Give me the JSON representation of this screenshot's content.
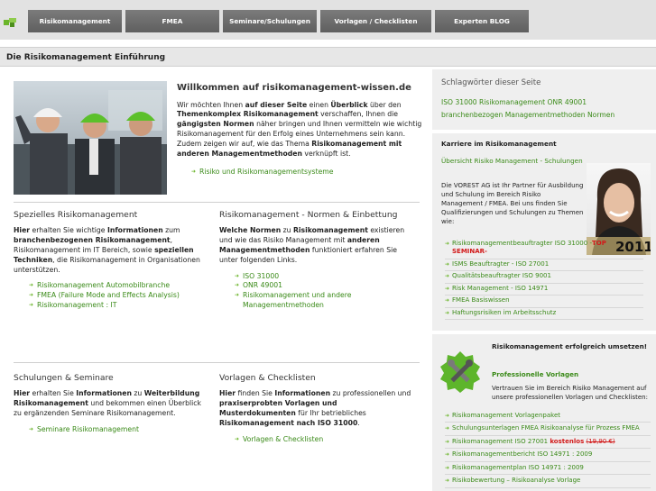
{
  "nav": {
    "items": [
      "Risikomanagement",
      "FMEA",
      "Seminare/Schulungen",
      "Vorlagen / Checklisten",
      "Experten BLOG"
    ]
  },
  "page": {
    "title": "Die Risikomanagement Einführung"
  },
  "welcome": {
    "title": "Willkommen auf risikomanagement-wissen.de",
    "t1": "Wir möchten Ihnen ",
    "b1": "auf dieser Seite",
    "t2": " einen ",
    "b2": "Überblick",
    "t3": " über den ",
    "b3": "Themenkomplex Risikomanagement",
    "t4": " verschaffen, Ihnen die ",
    "b4": "gängigsten Normen",
    "t5": " näher bringen und Ihnen vermitteln wie wichtig Risikomanagement für den Erfolg eines Unternehmens sein kann. Zudem zeigen wir auf, wie das Thema ",
    "b5": "Risikomanagement mit anderen Managementmethoden",
    "t6": " verknüpft ist.",
    "link": "Risiko und Risikomanagementsysteme"
  },
  "special": {
    "title": "Spezielles Risikomanagement",
    "b1": "Hier",
    "t1": " erhalten Sie wichtige ",
    "b2": "Informationen",
    "t2": " zum ",
    "b3": "branchenbezogenen Risikomanagement",
    "t3": ", Risikomanagement im IT Bereich, sowie ",
    "b4": "speziellen Techniken",
    "t4": ", die Risikomanagement in Organisationen unterstützen.",
    "links": [
      "Risikomanagement Automobilbranche",
      "FMEA (Failure Mode and Effects Analysis)",
      "Risikomanagement : IT"
    ]
  },
  "norms": {
    "title": "Risikomanagement - Normen & Einbettung",
    "b1": "Welche Normen",
    "t1": " zu ",
    "b2": "Risikomanagement",
    "t2": " existieren und wie das Risiko Management mit ",
    "b3": "anderen Managementmethoden",
    "t3": " funktioniert erfahren Sie unter folgenden Links.",
    "links": [
      "ISO 31000",
      "ONR 49001",
      "Risikomanagement und andere Managementmethoden"
    ]
  },
  "seminars": {
    "title": "Schulungen & Seminare",
    "b1": "Hier",
    "t1": " erhalten Sie ",
    "b2": "Informationen",
    "t2": " zu ",
    "b3": "Weiterbildung Risikomanagement",
    "t3": " und bekommen einen Überblick zu ergänzenden Seminare Risikomanagement.",
    "link": "Seminare Risikomanagement"
  },
  "templates": {
    "title": "Vorlagen & Checklisten",
    "b1": "Hier",
    "t1": " finden Sie ",
    "b2": "Informationen",
    "t2": " zu professionellen und ",
    "b3": "praxiserprobten Vorlagen und Musterdokumenten",
    "t3": " für Ihr betriebliches ",
    "b4": "Risikomanagement nach ISO 31000",
    "t4": ".",
    "link": "Vorlagen & Checklisten"
  },
  "sidebar": {
    "tags_title": "Schlagwörter dieser Seite",
    "tags": [
      "ISO 31000",
      "Risikomanagement",
      "ONR 49001",
      "branchenbezogen",
      "Managementmethoden",
      "Normen"
    ],
    "career": {
      "title": "Karriere im Risikomanagement",
      "link": "Übersicht Risiko Management - Schulungen",
      "text": "Die VOREST AG ist Ihr Partner für Ausbildung und Schulung im Bereich Risiko Management / FMEA. Bei uns finden Sie Qualifizierungen und Schulungen zu Themen wie:",
      "badge": "2011",
      "item0_a": "Risikomanagementbeauftragter ISO 31000 -",
      "item0_b": "TOP SEMINAR-",
      "items": [
        "ISMS Beauftragter - ISO 27001",
        "Qualitätsbeauftragter ISO 9001",
        "Risk Management - ISO 14971",
        "FMEA Basiswissen",
        "Haftungsrisiken im Arbeitsschutz"
      ]
    },
    "templates": {
      "title": "Risikomanagement erfolgreich umsetzen!",
      "subtitle": "Professionelle Vorlagen",
      "text": "Vertrauen Sie im Bereich Risiko Management auf unsere professionellen Vorlagen und Checklisten:",
      "items": [
        "Risikomanagement Vorlagenpaket",
        "Schulungsunterlagen FMEA Risikoanalyse für Prozess FMEA"
      ],
      "item2_a": "Risikomanagement ISO 27001 ",
      "item2_b": "kostenlos",
      "item2_c": "(19,90 €)",
      "items_rest": [
        "Risikomanagementbericht ISO 14971 : 2009",
        "Risikomanagementplan ISO 14971 : 2009",
        "Risikobewertung – Risikoanalyse Vorlage"
      ]
    }
  },
  "colors": {
    "link_green": "#3a8a18",
    "nav_gray": "#6d6d6d",
    "accent_red": "#d21919"
  }
}
